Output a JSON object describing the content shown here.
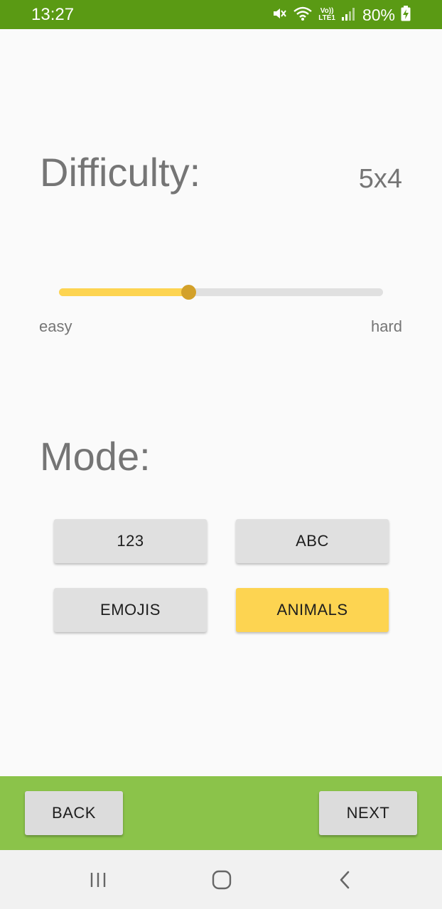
{
  "status_bar": {
    "time": "13:27",
    "battery": "80%",
    "icons": [
      "mute-icon",
      "wifi-icon",
      "volte-icon",
      "signal-icon",
      "battery-charging-icon"
    ],
    "volte_label_top": "Vo))",
    "volte_label_bottom": "LTE1"
  },
  "difficulty": {
    "label": "Difficulty:",
    "value": "5x4",
    "slider": {
      "min_label": "easy",
      "max_label": "hard",
      "level": 0.4
    }
  },
  "mode": {
    "label": "Mode:",
    "options": [
      "123",
      "ABC",
      "EMOJIS",
      "ANIMALS"
    ],
    "selected": "ANIMALS"
  },
  "bottom_bar": {
    "back_label": "BACK",
    "next_label": "NEXT"
  },
  "system_nav": {
    "icons": [
      "recent-apps-icon",
      "home-icon",
      "back-icon"
    ]
  },
  "colors": {
    "status_bar": "#5a9a14",
    "accent": "#fdd451",
    "thumb": "#d3a12a",
    "bottom_bar": "#8bc34a",
    "text_gray": "#757575"
  }
}
